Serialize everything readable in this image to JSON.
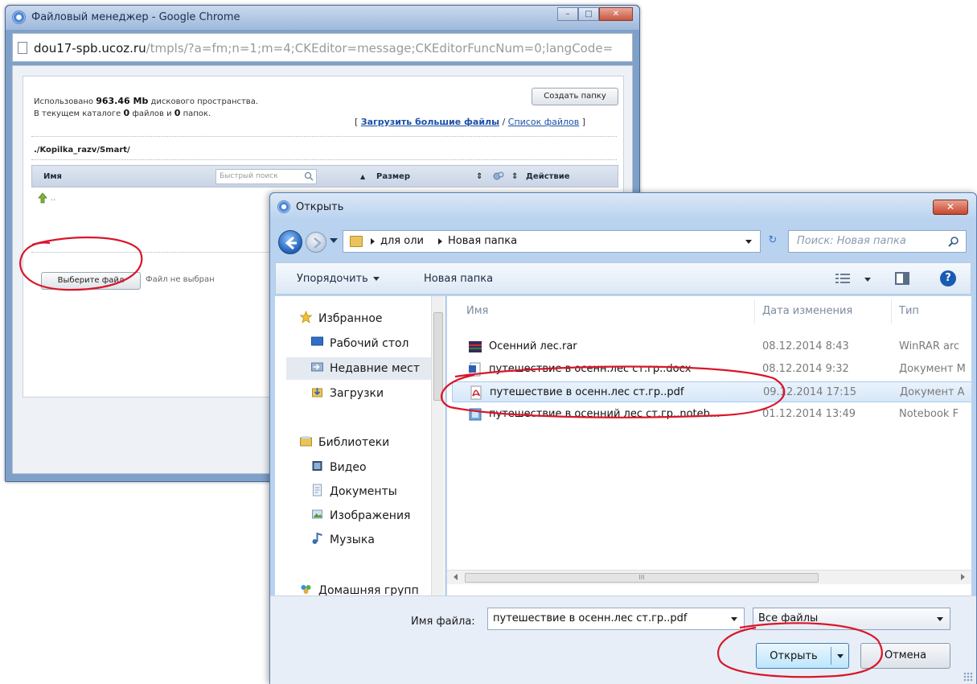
{
  "chrome": {
    "title": "Файловый менеджер - Google Chrome",
    "min": "–",
    "max": "□",
    "close": "✕",
    "url_domain": "dou17-spb.ucoz.ru",
    "url_rest": "/tmpls/?a=fm;n=1;m=4;CKEditor=message;CKEditorFuncNum=0;langCode="
  },
  "file_manager": {
    "usage_prefix": "Использовано ",
    "usage_value": "963.46 Mb",
    "usage_suffix": " дискового пространства.",
    "dir_prefix": "В текущем каталоге ",
    "dir_files": "0",
    "dir_mid": " файлов и ",
    "dir_folders": "0",
    "dir_suffix": " папок.",
    "create_folder": "Создать папку",
    "link_open": "[ ",
    "upload_big": "Загрузить большие файлы",
    "link_sep": " / ",
    "file_list": "Список файлов",
    "link_close": " ]",
    "path": "./Kopilka_razv/Smart/",
    "col_name": "Имя",
    "quick_search": "Быстрый поиск",
    "col_size": "Размер",
    "col_action": "Действие",
    "sort_asc": "▲",
    "sort_both": "⇕",
    "up_label": "..",
    "choose_file": "Выберите файл",
    "no_file": "Файл не выбран"
  },
  "dialog": {
    "title": "Открыть",
    "close": "✕",
    "crumbs": [
      "для оли",
      "Новая папка"
    ],
    "refresh": "↻",
    "search_placeholder": "Поиск: Новая папка",
    "organize": "Упорядочить",
    "new_folder": "Новая папка",
    "help": "?",
    "nav": {
      "favorites": "Избранное",
      "desktop": "Рабочий стол",
      "recent": "Недавние мест",
      "downloads": "Загрузки",
      "libraries": "Библиотеки",
      "video": "Видео",
      "documents": "Документы",
      "images": "Изображения",
      "music": "Музыка",
      "homegroup": "Домашняя групп"
    },
    "columns": {
      "name": "Имя",
      "date": "Дата изменения",
      "type": "Тип"
    },
    "files": [
      {
        "name": "Осенний лес.rar",
        "date": "08.12.2014 8:43",
        "type": "WinRAR arc"
      },
      {
        "name": "путешествие в осенн.лес ст.гр..docx",
        "date": "08.12.2014 9:32",
        "type": "Документ M"
      },
      {
        "name": "путешествие в осенн.лес ст.гр..pdf",
        "date": "09.12.2014 17:15",
        "type": "Документ A"
      },
      {
        "name": "путешествие в осенний лес ст.гр..noteb...",
        "date": "01.12.2014 13:49",
        "type": "Notebook F"
      }
    ],
    "scroll_grip": "III",
    "filename_label": "Имя файла:",
    "filename_value": "путешествие в осенн.лес ст.гр..pdf",
    "filter": "Все файлы",
    "open": "Открыть",
    "cancel": "Отмена"
  },
  "colors": {
    "annotation_red": "#d9162a",
    "dialog_frame": "#b8d2ef",
    "chrome_frame": "#7fa0c8",
    "selection": "#d6e7f8"
  }
}
